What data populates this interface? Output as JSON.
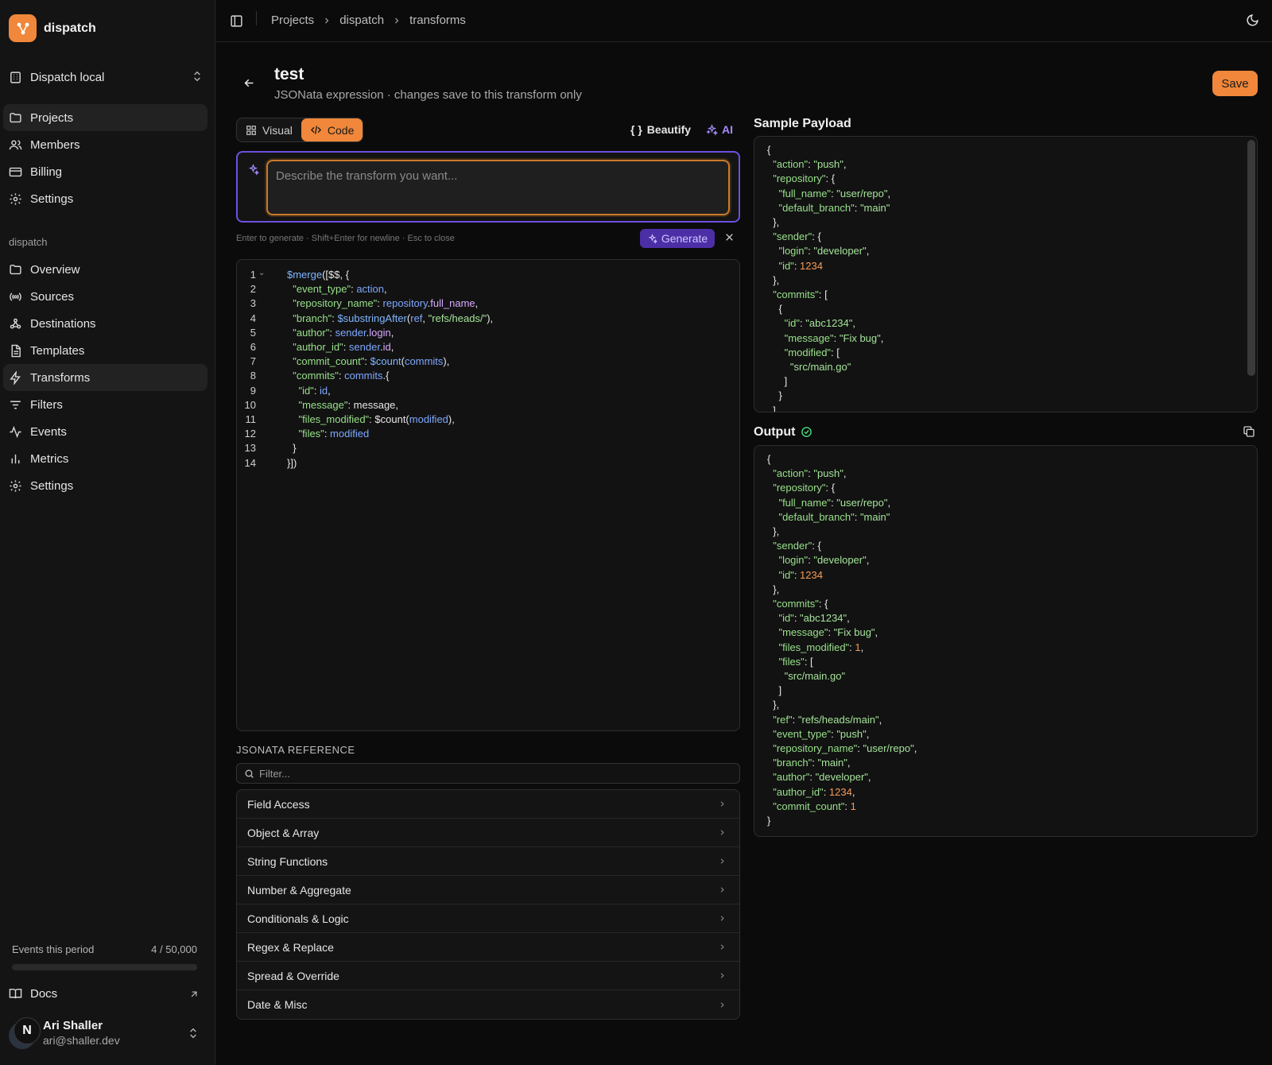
{
  "brand": {
    "name": "dispatch",
    "accent": "#f0873a"
  },
  "org": {
    "name": "Dispatch local"
  },
  "main_nav": [
    {
      "label": "Projects",
      "icon": "folder-icon",
      "active": true
    },
    {
      "label": "Members",
      "icon": "users-icon",
      "active": false
    },
    {
      "label": "Billing",
      "icon": "credit-card-icon",
      "active": false
    },
    {
      "label": "Settings",
      "icon": "gear-icon",
      "active": false
    }
  ],
  "project_section_label": "dispatch",
  "project_nav": [
    {
      "label": "Overview",
      "icon": "folder-icon",
      "active": false
    },
    {
      "label": "Sources",
      "icon": "radio-icon",
      "active": false
    },
    {
      "label": "Destinations",
      "icon": "webhook-icon",
      "active": false
    },
    {
      "label": "Templates",
      "icon": "file-text-icon",
      "active": false
    },
    {
      "label": "Transforms",
      "icon": "zap-icon",
      "active": true
    },
    {
      "label": "Filters",
      "icon": "filter-icon",
      "active": false
    },
    {
      "label": "Events",
      "icon": "activity-icon",
      "active": false
    },
    {
      "label": "Metrics",
      "icon": "bar-chart-icon",
      "active": false
    },
    {
      "label": "Settings",
      "icon": "gear-icon",
      "active": false
    }
  ],
  "usage": {
    "label": "Events this period",
    "value": "4 / 50,000",
    "fraction": 8e-05
  },
  "docs_label": "Docs",
  "user": {
    "initial": "N",
    "name": "Ari Shaller",
    "email": "ari@shaller.dev"
  },
  "breadcrumbs": [
    "Projects",
    "dispatch",
    "transforms"
  ],
  "header": {
    "title": "test",
    "subtitle": "JSONata expression · changes save to this transform only",
    "save_label": "Save"
  },
  "editor_modes": {
    "visual": "Visual",
    "code": "Code",
    "active": "code"
  },
  "toolbar": {
    "beautify": "Beautify",
    "beautify_glyph": "{ }",
    "ai": "AI"
  },
  "ai_prompt": {
    "placeholder": "Describe the transform you want...",
    "value": "",
    "hint": "Enter to generate · Shift+Enter for newline · Esc to close",
    "generate_label": "Generate"
  },
  "code_lines": [
    [
      [
        "f",
        "$merge"
      ],
      [
        "p",
        "([$$, {"
      ]
    ],
    [
      [
        "p",
        "  "
      ],
      [
        "k",
        "\"event_type\""
      ],
      [
        "p",
        ": "
      ],
      [
        "v",
        "action"
      ],
      [
        "p",
        ","
      ]
    ],
    [
      [
        "p",
        "  "
      ],
      [
        "k",
        "\"repository_name\""
      ],
      [
        "p",
        ": "
      ],
      [
        "v",
        "repository"
      ],
      [
        "p",
        "."
      ],
      [
        "pv",
        "full_name"
      ],
      [
        "p",
        ","
      ]
    ],
    [
      [
        "p",
        "  "
      ],
      [
        "k",
        "\"branch\""
      ],
      [
        "p",
        ": "
      ],
      [
        "f",
        "$substringAfter"
      ],
      [
        "p",
        "("
      ],
      [
        "v",
        "ref"
      ],
      [
        "p",
        ", "
      ],
      [
        "s",
        "\"refs/heads/\""
      ],
      [
        "p",
        "),"
      ]
    ],
    [
      [
        "p",
        "  "
      ],
      [
        "k",
        "\"author\""
      ],
      [
        "p",
        ": "
      ],
      [
        "v",
        "sender"
      ],
      [
        "p",
        "."
      ],
      [
        "pv",
        "login"
      ],
      [
        "p",
        ","
      ]
    ],
    [
      [
        "p",
        "  "
      ],
      [
        "k",
        "\"author_id\""
      ],
      [
        "p",
        ": "
      ],
      [
        "v",
        "sender"
      ],
      [
        "p",
        "."
      ],
      [
        "pv",
        "id"
      ],
      [
        "p",
        ","
      ]
    ],
    [
      [
        "p",
        "  "
      ],
      [
        "k",
        "\"commit_count\""
      ],
      [
        "p",
        ": "
      ],
      [
        "f",
        "$count"
      ],
      [
        "p",
        "("
      ],
      [
        "v",
        "commits"
      ],
      [
        "p",
        "),"
      ]
    ],
    [
      [
        "p",
        "  "
      ],
      [
        "k",
        "\"commits\""
      ],
      [
        "p",
        ": "
      ],
      [
        "v",
        "commits"
      ],
      [
        "p",
        ".{"
      ]
    ],
    [
      [
        "p",
        "    "
      ],
      [
        "k",
        "\"id\""
      ],
      [
        "p",
        ": "
      ],
      [
        "v",
        "id"
      ],
      [
        "p",
        ","
      ]
    ],
    [
      [
        "p",
        "    "
      ],
      [
        "k",
        "\"message\""
      ],
      [
        "p",
        ": message,"
      ]
    ],
    [
      [
        "p",
        "    "
      ],
      [
        "k",
        "\"files_modified\""
      ],
      [
        "p",
        ": $count("
      ],
      [
        "v",
        "modified"
      ],
      [
        "p",
        "),"
      ]
    ],
    [
      [
        "p",
        "    "
      ],
      [
        "k",
        "\"files\""
      ],
      [
        "p",
        ": "
      ],
      [
        "v",
        "modified"
      ]
    ],
    [
      [
        "p",
        "  }"
      ]
    ],
    [
      [
        "p",
        "}])"
      ]
    ]
  ],
  "reference": {
    "title": "JSONATA REFERENCE",
    "filter_placeholder": "Filter...",
    "items": [
      "Field Access",
      "Object & Array",
      "String Functions",
      "Number & Aggregate",
      "Conditionals & Logic",
      "Regex & Replace",
      "Spread & Override",
      "Date & Misc"
    ]
  },
  "sample_payload": {
    "title": "Sample Payload",
    "lines": [
      [
        [
          "p",
          "{"
        ]
      ],
      [
        [
          "p",
          "  "
        ],
        [
          "k",
          "\"action\""
        ],
        [
          "p",
          ": "
        ],
        [
          "s",
          "\"push\""
        ],
        [
          "p",
          ","
        ]
      ],
      [
        [
          "p",
          "  "
        ],
        [
          "k",
          "\"repository\""
        ],
        [
          "p",
          ": {"
        ]
      ],
      [
        [
          "p",
          "    "
        ],
        [
          "k",
          "\"full_name\""
        ],
        [
          "p",
          ": "
        ],
        [
          "s",
          "\"user/repo\""
        ],
        [
          "p",
          ","
        ]
      ],
      [
        [
          "p",
          "    "
        ],
        [
          "k",
          "\"default_branch\""
        ],
        [
          "p",
          ": "
        ],
        [
          "s",
          "\"main\""
        ]
      ],
      [
        [
          "p",
          "  },"
        ]
      ],
      [
        [
          "p",
          "  "
        ],
        [
          "k",
          "\"sender\""
        ],
        [
          "p",
          ": {"
        ]
      ],
      [
        [
          "p",
          "    "
        ],
        [
          "k",
          "\"login\""
        ],
        [
          "p",
          ": "
        ],
        [
          "s",
          "\"developer\""
        ],
        [
          "p",
          ","
        ]
      ],
      [
        [
          "p",
          "    "
        ],
        [
          "k",
          "\"id\""
        ],
        [
          "p",
          ": "
        ],
        [
          "n",
          "1234"
        ]
      ],
      [
        [
          "p",
          "  },"
        ]
      ],
      [
        [
          "p",
          "  "
        ],
        [
          "k",
          "\"commits\""
        ],
        [
          "p",
          ": ["
        ]
      ],
      [
        [
          "p",
          "    {"
        ]
      ],
      [
        [
          "p",
          "      "
        ],
        [
          "k",
          "\"id\""
        ],
        [
          "p",
          ": "
        ],
        [
          "s",
          "\"abc1234\""
        ],
        [
          "p",
          ","
        ]
      ],
      [
        [
          "p",
          "      "
        ],
        [
          "k",
          "\"message\""
        ],
        [
          "p",
          ": "
        ],
        [
          "s",
          "\"Fix bug\""
        ],
        [
          "p",
          ","
        ]
      ],
      [
        [
          "p",
          "      "
        ],
        [
          "k",
          "\"modified\""
        ],
        [
          "p",
          ": ["
        ]
      ],
      [
        [
          "p",
          "        "
        ],
        [
          "s",
          "\"src/main.go\""
        ]
      ],
      [
        [
          "p",
          "      ]"
        ]
      ],
      [
        [
          "p",
          "    }"
        ]
      ],
      [
        [
          "p",
          "  ]"
        ]
      ]
    ]
  },
  "output": {
    "title": "Output",
    "lines": [
      [
        [
          "p",
          "{"
        ]
      ],
      [
        [
          "p",
          "  "
        ],
        [
          "k",
          "\"action\""
        ],
        [
          "p",
          ": "
        ],
        [
          "s",
          "\"push\""
        ],
        [
          "p",
          ","
        ]
      ],
      [
        [
          "p",
          "  "
        ],
        [
          "k",
          "\"repository\""
        ],
        [
          "p",
          ": {"
        ]
      ],
      [
        [
          "p",
          "    "
        ],
        [
          "k",
          "\"full_name\""
        ],
        [
          "p",
          ": "
        ],
        [
          "s",
          "\"user/repo\""
        ],
        [
          "p",
          ","
        ]
      ],
      [
        [
          "p",
          "    "
        ],
        [
          "k",
          "\"default_branch\""
        ],
        [
          "p",
          ": "
        ],
        [
          "s",
          "\"main\""
        ]
      ],
      [
        [
          "p",
          "  },"
        ]
      ],
      [
        [
          "p",
          "  "
        ],
        [
          "k",
          "\"sender\""
        ],
        [
          "p",
          ": {"
        ]
      ],
      [
        [
          "p",
          "    "
        ],
        [
          "k",
          "\"login\""
        ],
        [
          "p",
          ": "
        ],
        [
          "s",
          "\"developer\""
        ],
        [
          "p",
          ","
        ]
      ],
      [
        [
          "p",
          "    "
        ],
        [
          "k",
          "\"id\""
        ],
        [
          "p",
          ": "
        ],
        [
          "n",
          "1234"
        ]
      ],
      [
        [
          "p",
          "  },"
        ]
      ],
      [
        [
          "p",
          "  "
        ],
        [
          "k",
          "\"commits\""
        ],
        [
          "p",
          ": {"
        ]
      ],
      [
        [
          "p",
          "    "
        ],
        [
          "k",
          "\"id\""
        ],
        [
          "p",
          ": "
        ],
        [
          "s",
          "\"abc1234\""
        ],
        [
          "p",
          ","
        ]
      ],
      [
        [
          "p",
          "    "
        ],
        [
          "k",
          "\"message\""
        ],
        [
          "p",
          ": "
        ],
        [
          "s",
          "\"Fix bug\""
        ],
        [
          "p",
          ","
        ]
      ],
      [
        [
          "p",
          "    "
        ],
        [
          "k",
          "\"files_modified\""
        ],
        [
          "p",
          ": "
        ],
        [
          "n",
          "1"
        ],
        [
          "p",
          ","
        ]
      ],
      [
        [
          "p",
          "    "
        ],
        [
          "k",
          "\"files\""
        ],
        [
          "p",
          ": ["
        ]
      ],
      [
        [
          "p",
          "      "
        ],
        [
          "s",
          "\"src/main.go\""
        ]
      ],
      [
        [
          "p",
          "    ]"
        ]
      ],
      [
        [
          "p",
          "  },"
        ]
      ],
      [
        [
          "p",
          "  "
        ],
        [
          "k",
          "\"ref\""
        ],
        [
          "p",
          ": "
        ],
        [
          "s",
          "\"refs/heads/main\""
        ],
        [
          "p",
          ","
        ]
      ],
      [
        [
          "p",
          "  "
        ],
        [
          "k",
          "\"event_type\""
        ],
        [
          "p",
          ": "
        ],
        [
          "s",
          "\"push\""
        ],
        [
          "p",
          ","
        ]
      ],
      [
        [
          "p",
          "  "
        ],
        [
          "k",
          "\"repository_name\""
        ],
        [
          "p",
          ": "
        ],
        [
          "s",
          "\"user/repo\""
        ],
        [
          "p",
          ","
        ]
      ],
      [
        [
          "p",
          "  "
        ],
        [
          "k",
          "\"branch\""
        ],
        [
          "p",
          ": "
        ],
        [
          "s",
          "\"main\""
        ],
        [
          "p",
          ","
        ]
      ],
      [
        [
          "p",
          "  "
        ],
        [
          "k",
          "\"author\""
        ],
        [
          "p",
          ": "
        ],
        [
          "s",
          "\"developer\""
        ],
        [
          "p",
          ","
        ]
      ],
      [
        [
          "p",
          "  "
        ],
        [
          "k",
          "\"author_id\""
        ],
        [
          "p",
          ": "
        ],
        [
          "n",
          "1234"
        ],
        [
          "p",
          ","
        ]
      ],
      [
        [
          "p",
          "  "
        ],
        [
          "k",
          "\"commit_count\""
        ],
        [
          "p",
          ": "
        ],
        [
          "n",
          "1"
        ]
      ],
      [
        [
          "p",
          "}"
        ]
      ]
    ]
  }
}
